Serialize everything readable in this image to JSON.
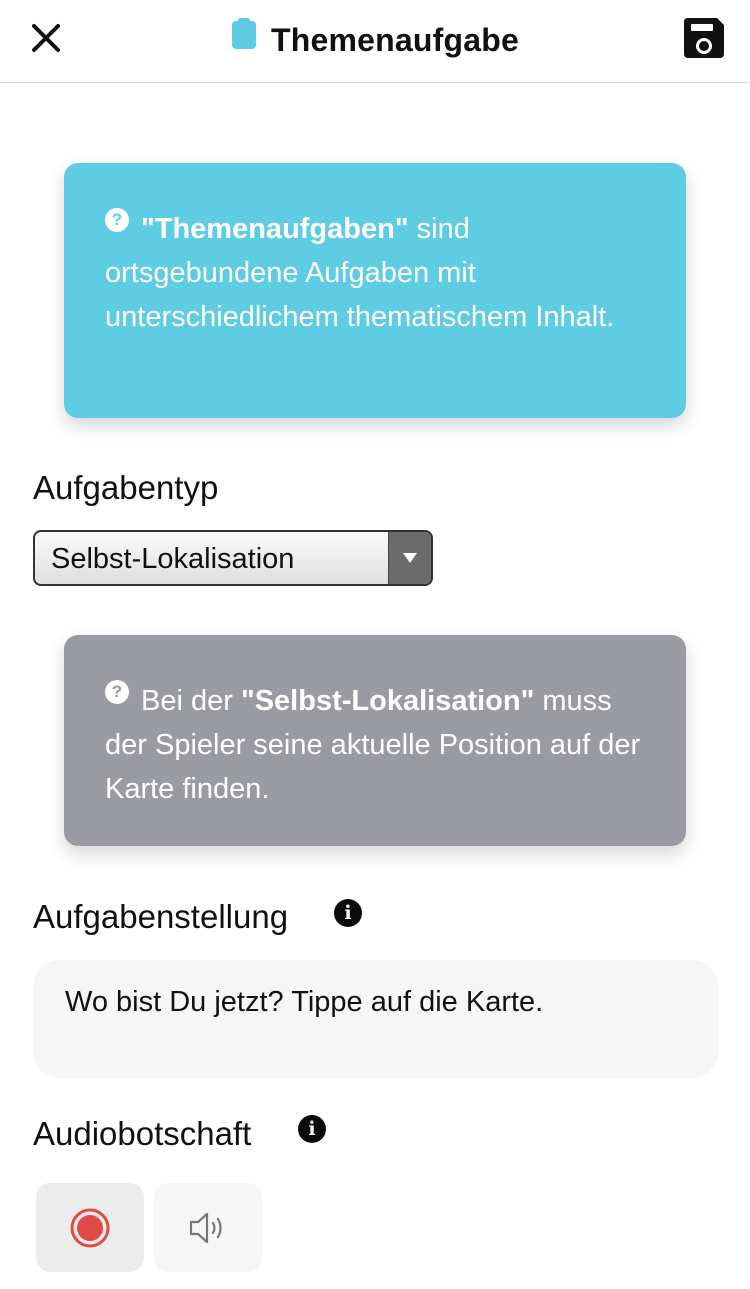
{
  "header": {
    "title": "Themenaufgabe",
    "title_icon": "clipboard-icon",
    "close_icon": "close-icon",
    "save_icon": "save-disk-icon"
  },
  "intro_box": {
    "highlight": "\"Themenaufgaben\"",
    "text": " sind ortsgebundene Aufgaben mit unterschiedlichem thematischem Inhalt.",
    "icon": "question-icon",
    "color": "#5ecde3"
  },
  "task_type": {
    "label": "Aufgabentyp",
    "selected": "Selbst-Lokalisation"
  },
  "type_box": {
    "prefix": "Bei der ",
    "highlight": "\"Selbst-Lokalisation\"",
    "text": " muss der Spieler seine aktuelle Position auf der Karte finden.",
    "icon": "question-icon",
    "color": "#999aa2"
  },
  "task_statement": {
    "label": "Aufgabenstellung",
    "value": "Wo bist Du jetzt? Tippe auf die Karte.",
    "info_icon": "info-icon"
  },
  "audio": {
    "label": "Audiobotschaft",
    "info_icon": "info-icon",
    "record_icon": "record-icon",
    "play_icon": "speaker-icon",
    "record_color": "#e24a45"
  }
}
